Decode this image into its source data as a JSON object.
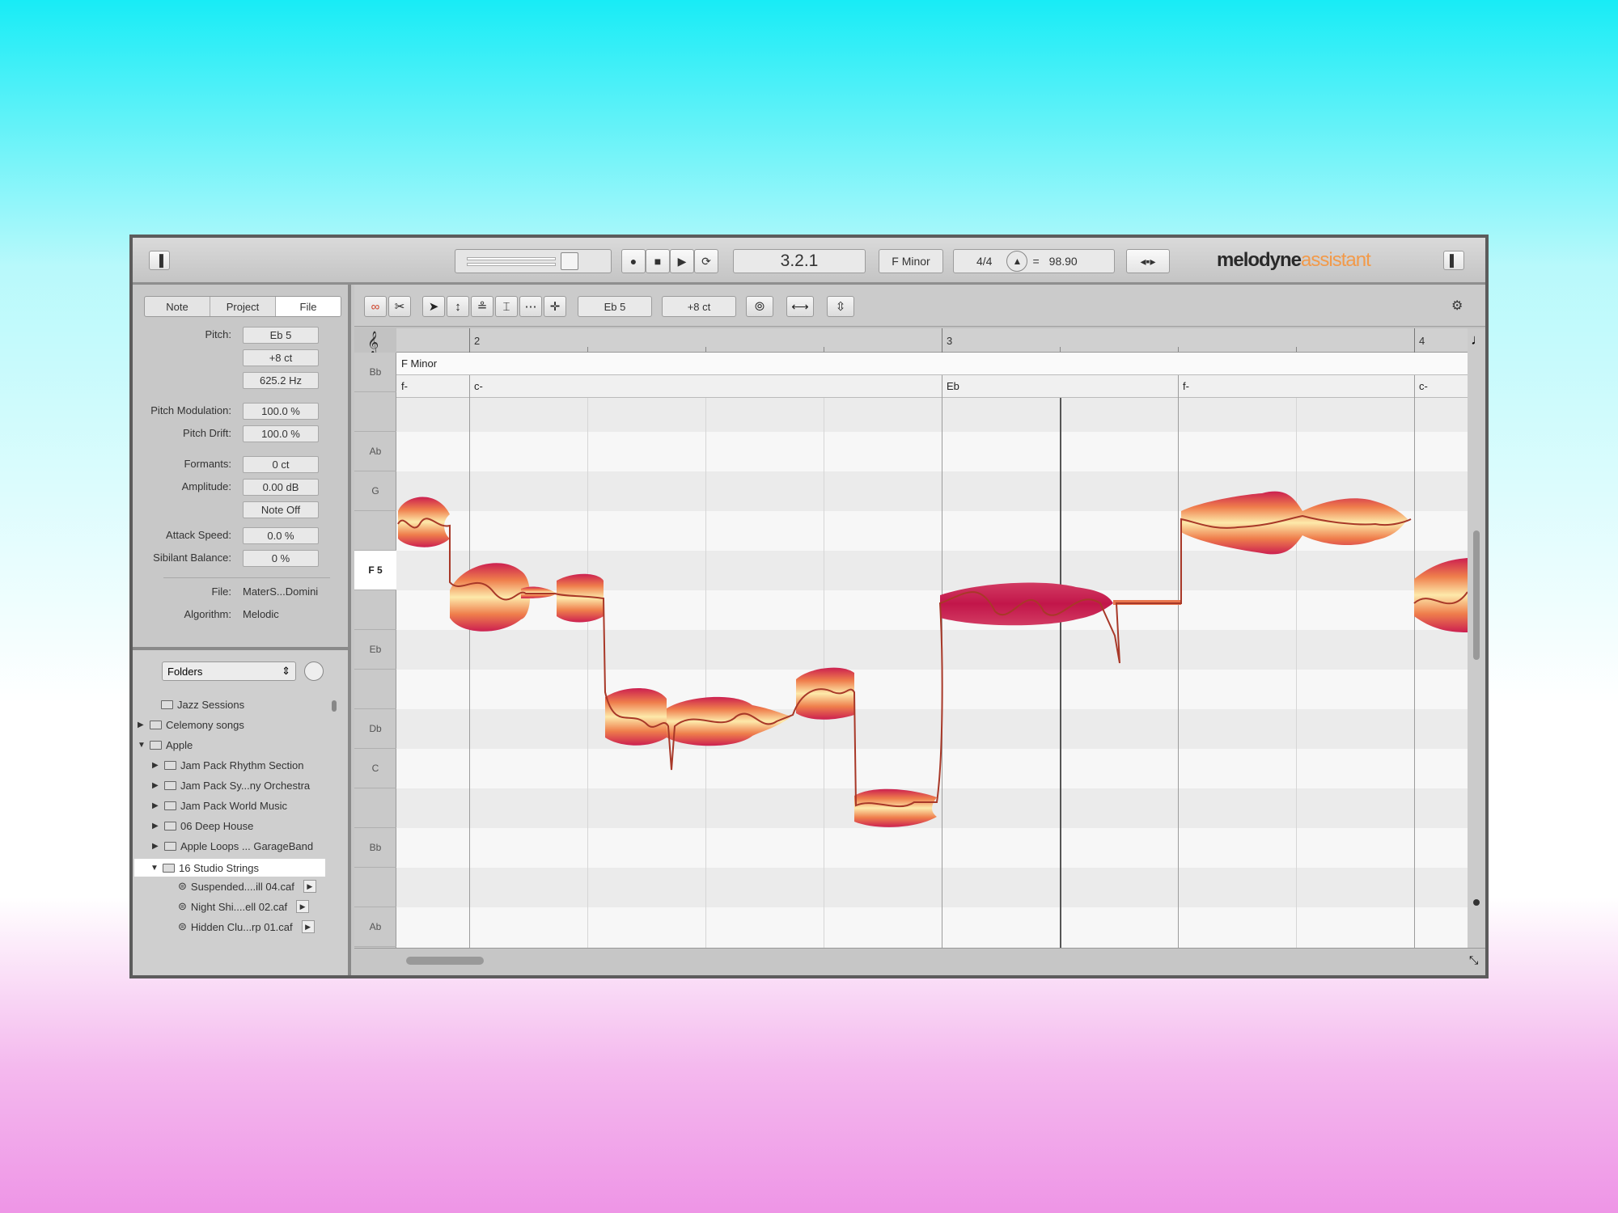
{
  "titlebar": {
    "position": "3.2.1",
    "key": "F Minor",
    "meter": "4/4",
    "tempo_eq": "=",
    "tempo": "98.90",
    "logo_main": "melodyne",
    "logo_sub": "assistant"
  },
  "left_panel": {
    "tabs": [
      "Note",
      "Project",
      "File"
    ],
    "active_tab": "File",
    "params": {
      "pitch_label": "Pitch:",
      "pitch": "Eb 5",
      "pitch_cents": "+8 ct",
      "pitch_hz": "625.2 Hz",
      "pitch_mod_label": "Pitch Modulation:",
      "pitch_mod": "100.0 %",
      "pitch_drift_label": "Pitch Drift:",
      "pitch_drift": "100.0 %",
      "formants_label": "Formants:",
      "formants": "0 ct",
      "amplitude_label": "Amplitude:",
      "amplitude": "0.00 dB",
      "note_off": "Note Off",
      "attack_label": "Attack Speed:",
      "attack": "0.0 %",
      "sibilant_label": "Sibilant Balance:",
      "sibilant": "0 %",
      "file_label": "File:",
      "file": "MaterS...Domini",
      "algorithm_label": "Algorithm:",
      "algorithm": "Melodic"
    },
    "browser": {
      "mode": "Folders",
      "items": [
        "Jazz Sessions",
        "Celemony songs",
        "Apple",
        "Jam Pack Rhythm Section",
        "Jam Pack Sy...ny Orchestra",
        "Jam Pack World Music",
        "06 Deep House",
        "Apple Loops ... GarageBand",
        "16 Studio Strings",
        "Suspended....ill 04.caf",
        "Night Shi....ell 02.caf",
        "Hidden Clu...rp 01.caf"
      ]
    }
  },
  "editor": {
    "toolbar": {
      "pitch": "Eb 5",
      "cents": "+8 ct"
    },
    "bars": [
      "2",
      "3",
      "4"
    ],
    "scale": "F Minor",
    "chords": [
      "f-",
      "c-",
      "Eb",
      "f-",
      "c-"
    ],
    "keys": [
      "Bb",
      "",
      "Ab",
      "G",
      "",
      "F 5",
      "",
      "Eb",
      "",
      "Db",
      "C",
      "",
      "Bb",
      "",
      "Ab"
    ],
    "active_key": "F 5"
  },
  "colors": {
    "blob_dark": "#cc2050",
    "blob_mid": "#ef7e4c",
    "blob_light": "#fde9aa",
    "pitch_line": "#a83828"
  }
}
